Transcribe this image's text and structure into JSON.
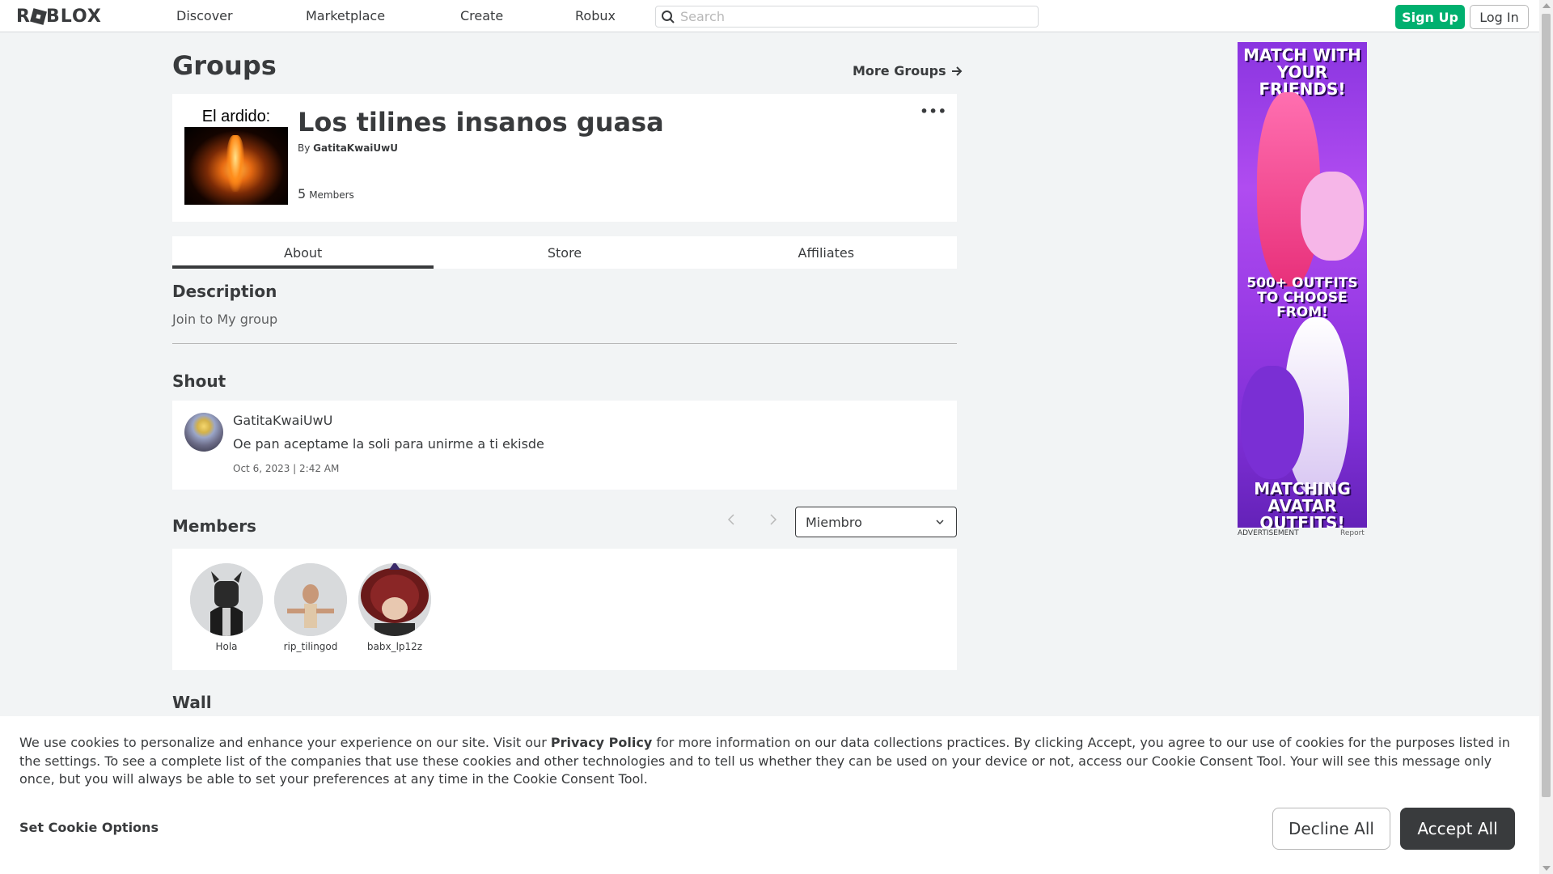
{
  "nav": {
    "logo": "ROBLOX",
    "links": [
      "Discover",
      "Marketplace",
      "Create",
      "Robux"
    ],
    "search_placeholder": "Search",
    "signup": "Sign Up",
    "login": "Log In"
  },
  "page": {
    "title": "Groups",
    "more_groups": "More Groups"
  },
  "group": {
    "emblem_caption": "El ardido:",
    "name": "Los tilines insanos guasa",
    "owner_prefix": "By",
    "owner": "GatitaKwaiUwU",
    "member_count": "5",
    "member_label": "Members",
    "menu": "•••"
  },
  "tabs": [
    "About",
    "Store",
    "Affiliates"
  ],
  "about": {
    "description_title": "Description",
    "description": "Join to My group",
    "shout_title": "Shout",
    "shout": {
      "user": "GatitaKwaiUwU",
      "body": "Oe pan aceptame la soli para unirme a ti ekisde",
      "date": "Oct 6, 2023 | 2:42 AM"
    },
    "members_title": "Members",
    "role_filter": "Miembro",
    "members": [
      {
        "name": "Hola"
      },
      {
        "name": "rip_tilingod"
      },
      {
        "name": "babx_lp12z"
      }
    ],
    "wall_title": "Wall"
  },
  "ad": {
    "line1": "MATCH WITH YOUR FRIENDS!",
    "line2": "500+ OUTFITS TO CHOOSE FROM!",
    "line3": "MATCHING AVATAR OUTFITS!",
    "label": "ADVERTISEMENT",
    "report": "Report"
  },
  "cookie": {
    "text_before": "We use cookies to personalize and enhance your experience on our site. Visit our ",
    "link": "Privacy Policy",
    "text_after": " for more information on our data collections practices. By clicking Accept, you agree to our use of cookies for the purposes listed in the settings. To see a complete list of the companies that use these cookies and other technologies and to tell us whether they can be used on your device or not, access our Cookie Consent Tool. Your will see this message only once, but you will always be able to set your preferences at any time in the Cookie Consent Tool.",
    "set_options": "Set Cookie Options",
    "decline": "Decline All",
    "accept": "Accept All"
  },
  "colors": {
    "accent_green": "#00b06f",
    "dark": "#393b3d",
    "background": "#f2f4f5"
  }
}
